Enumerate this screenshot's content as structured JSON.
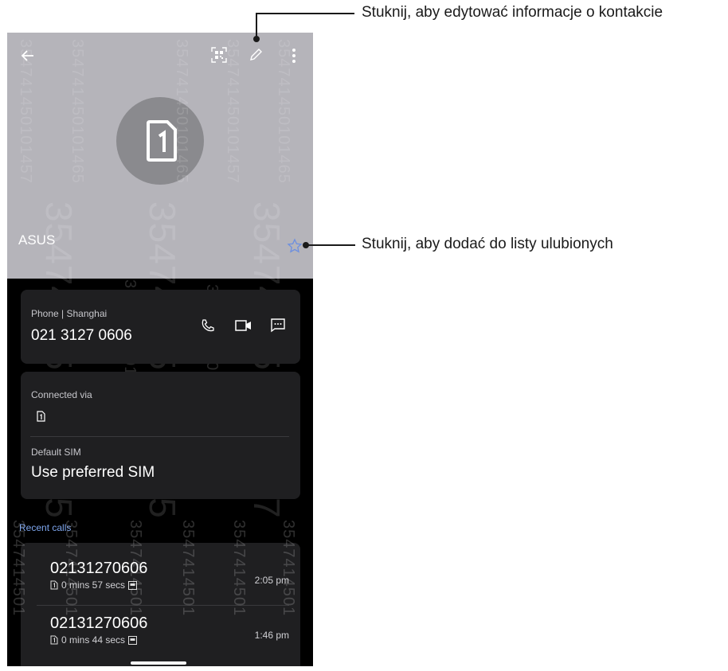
{
  "contact": {
    "name": "ASUS",
    "avatar_icon": "sim-card-1-icon"
  },
  "toolbar": {
    "back_icon": "back-arrow-icon",
    "qr_icon": "qr-code-icon",
    "edit_icon": "pencil-edit-icon",
    "more_icon": "more-vertical-icon",
    "favorite_icon": "star-outline-icon"
  },
  "phone_card": {
    "label": "Phone | Shanghai",
    "number": "021 3127 0606",
    "actions": [
      "phone-call-icon",
      "video-call-icon",
      "message-icon"
    ]
  },
  "sim_card": {
    "connected_label": "Connected via",
    "default_label": "Default SIM",
    "default_value": "Use preferred SIM"
  },
  "recent_calls": {
    "title": "Recent calls",
    "items": [
      {
        "number": "02131270606",
        "duration": "0 mins 57 secs",
        "time": "2:05 pm"
      },
      {
        "number": "02131270606",
        "duration": "0 mins 44 secs",
        "time": "1:46 pm"
      }
    ]
  },
  "watermark": {
    "long": "354741450101465",
    "long2": "354741450101457",
    "short": "3547414501"
  },
  "annotations": {
    "edit": "Stuknij, aby edytować informacje o kontakcie",
    "favorite": "Stuknij, aby dodać do listy ulubionych"
  },
  "colors": {
    "header_bg": "#b5b4ba",
    "card_bg": "#1f1f21",
    "accent": "#7ea6ee"
  }
}
